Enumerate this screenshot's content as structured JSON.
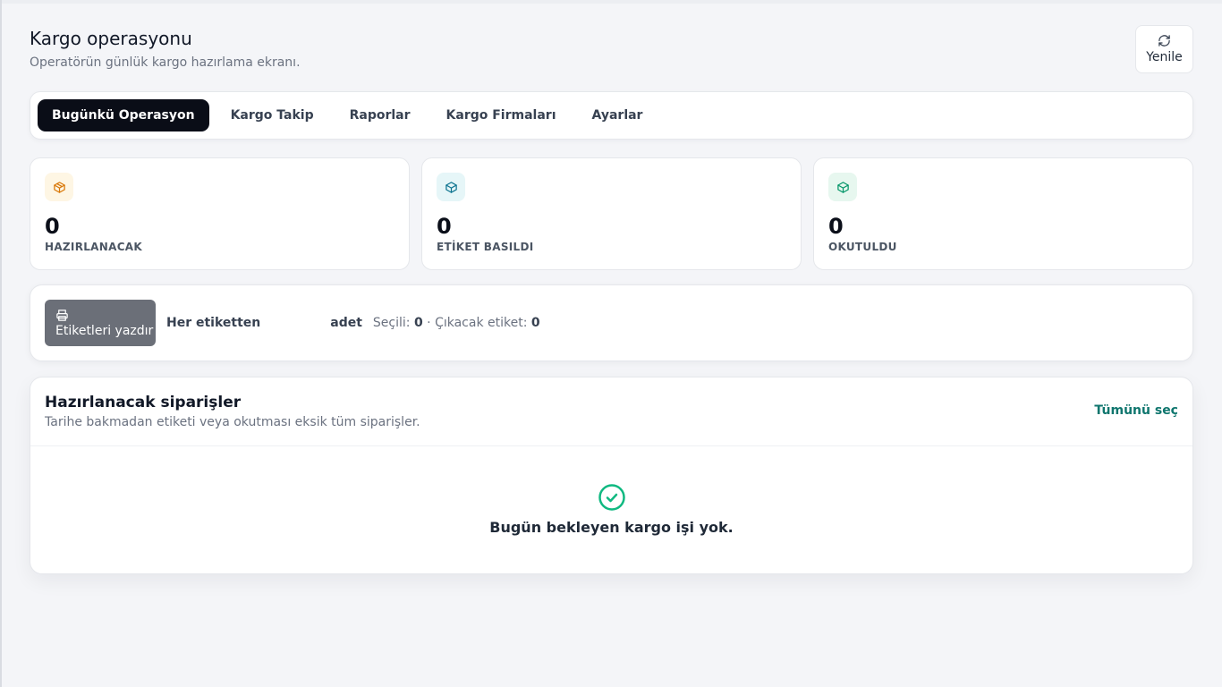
{
  "header": {
    "title": "Kargo operasyonu",
    "subtitle": "Operatörün günlük kargo hazırlama ekranı.",
    "refresh_label": "Yenile"
  },
  "tabs": [
    {
      "label": "Bugünkü Operasyon",
      "active": true
    },
    {
      "label": "Kargo Takip",
      "active": false
    },
    {
      "label": "Raporlar",
      "active": false
    },
    {
      "label": "Kargo Firmaları",
      "active": false
    },
    {
      "label": "Ayarlar",
      "active": false
    }
  ],
  "stats": [
    {
      "value": "0",
      "label": "HAZIRLANACAK",
      "icon": "box-icon",
      "color": "#d97706",
      "bg": "#fef6e4"
    },
    {
      "value": "0",
      "label": "ETİKET BASILDI",
      "icon": "box-icon",
      "color": "#0e7490",
      "bg": "#e6f6f8"
    },
    {
      "value": "0",
      "label": "OKUTULDU",
      "icon": "box-icon",
      "color": "#059669",
      "bg": "#e7f7ef"
    }
  ],
  "print_bar": {
    "print_label": "Etiketleri yazdır",
    "each_label": "Her etiketten",
    "qty_value": "",
    "unit_label": "adet",
    "selected_label": "Seçili:",
    "selected_value": "0",
    "separator": "·",
    "outgoing_label": "Çıkacak etiket:",
    "outgoing_value": "0"
  },
  "orders": {
    "title": "Hazırlanacak siparişler",
    "subtitle": "Tarihe bakmadan etiketi veya okutması eksik tüm siparişler.",
    "select_all_label": "Tümünü seç",
    "empty_text": "Bugün bekleyen kargo işi yok."
  },
  "colors": {
    "accent": "#0f766e",
    "tab_active_bg": "#0a0d17",
    "print_btn_bg": "#6b6f78",
    "success": "#10b981"
  }
}
